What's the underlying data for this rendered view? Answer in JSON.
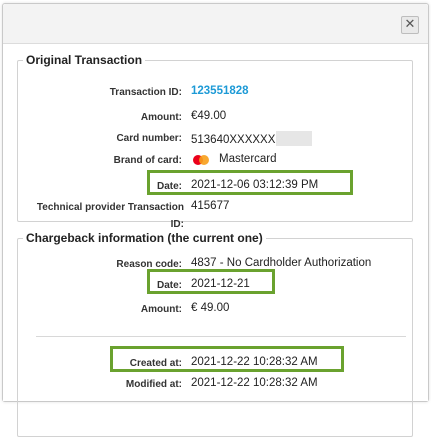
{
  "dialog": {
    "close_icon": "close-icon",
    "close_glyph": "✕"
  },
  "original": {
    "legend": "Original Transaction",
    "transaction_id_label": "Transaction ID:",
    "transaction_id": "123551828",
    "amount_label": "Amount:",
    "amount": "€49.00",
    "card_number_label": "Card number:",
    "card_number": "513640XXXXXX",
    "brand_label": "Brand of card:",
    "brand": "Mastercard",
    "brand_icon": "mastercard-logo",
    "date_label": "Date:",
    "date": "2021-12-06 03:12:39 PM",
    "tech_provider_label": "Technical provider Transaction ID:",
    "tech_provider_id": "415677"
  },
  "chargeback": {
    "legend": "Chargeback information (the current one)",
    "reason_code_label": "Reason code:",
    "reason_code": "4837 - No Cardholder Authorization",
    "date_label": "Date:",
    "date": "2021-12-21",
    "amount_label": "Amount:",
    "amount": "€ 49.00",
    "created_label": "Created at:",
    "created": "2021-12-22 10:28:32 AM",
    "modified_label": "Modified at:",
    "modified": "2021-12-22 10:28:32 AM"
  },
  "colors": {
    "highlight": "#6aa22f",
    "link": "#1d9ad6",
    "mastercard_red": "#eb001b",
    "mastercard_yellow": "#f79e1b"
  }
}
